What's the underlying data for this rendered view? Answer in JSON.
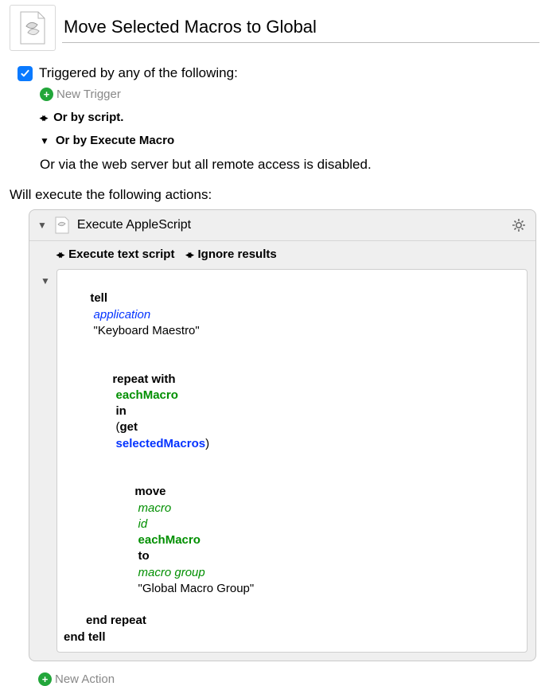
{
  "header": {
    "title": "Move Selected Macros to Global"
  },
  "triggers": {
    "heading": "Triggered by any of the following:",
    "new_trigger": "New Trigger",
    "by_script": "Or by script.",
    "by_execute_macro": "Or by Execute Macro",
    "via_web": "Or via the web server but all remote access is disabled."
  },
  "actions": {
    "heading": "Will execute the following actions:",
    "card": {
      "title": "Execute AppleScript",
      "opt_script": "Execute text script",
      "opt_results": "Ignore results"
    },
    "code": {
      "l1_kw1": "tell",
      "l1_app": "application",
      "l1_str": "\"Keyboard Maestro\"",
      "l2_kw1": "repeat with",
      "l2_var": "eachMacro",
      "l2_kw2": "in",
      "l2_kw3": "get",
      "l2_sel": "selectedMacros",
      "l3_kw1": "move",
      "l3_macro": "macro",
      "l3_id": "id",
      "l3_var": "eachMacro",
      "l3_kw2": "to",
      "l3_group": "macro group",
      "l3_str": "\"Global Macro Group\"",
      "l4": "end repeat",
      "l5": "end tell"
    },
    "new_action": "New Action"
  }
}
